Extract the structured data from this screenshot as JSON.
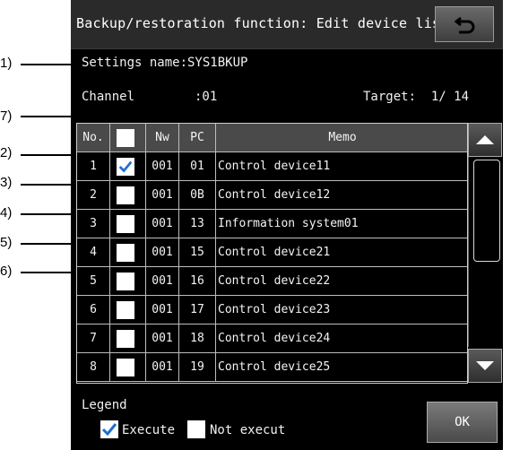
{
  "title": "Backup/restoration function: Edit device list",
  "settings_name": "Settings name:SYS1BKUP",
  "channel_label": "Channel",
  "channel_value": ":01",
  "target": "Target:  1/ 14",
  "table": {
    "headers": [
      "No.",
      "",
      "Nw",
      "PC",
      "Memo"
    ],
    "rows": [
      {
        "no": "1",
        "checked": true,
        "nw": "001",
        "pc": "01",
        "memo": "Control device11"
      },
      {
        "no": "2",
        "checked": false,
        "nw": "001",
        "pc": "0B",
        "memo": "Control device12"
      },
      {
        "no": "3",
        "checked": false,
        "nw": "001",
        "pc": "13",
        "memo": "Information system01"
      },
      {
        "no": "4",
        "checked": false,
        "nw": "001",
        "pc": "15",
        "memo": "Control device21"
      },
      {
        "no": "5",
        "checked": false,
        "nw": "001",
        "pc": "16",
        "memo": "Control device22"
      },
      {
        "no": "6",
        "checked": false,
        "nw": "001",
        "pc": "17",
        "memo": "Control device23"
      },
      {
        "no": "7",
        "checked": false,
        "nw": "001",
        "pc": "18",
        "memo": "Control device24"
      },
      {
        "no": "8",
        "checked": false,
        "nw": "001",
        "pc": "19",
        "memo": "Control device25"
      }
    ]
  },
  "legend": {
    "title": "Legend",
    "execute": "Execute",
    "not_execute": "Not execut"
  },
  "ok_label": "OK",
  "callouts": [
    "1)",
    "2)",
    "3)",
    "4)",
    "5)",
    "6)",
    "7)"
  ],
  "colors": {
    "check": "#1e6fd0",
    "background": "#000000",
    "header": "#4a4a4a"
  }
}
